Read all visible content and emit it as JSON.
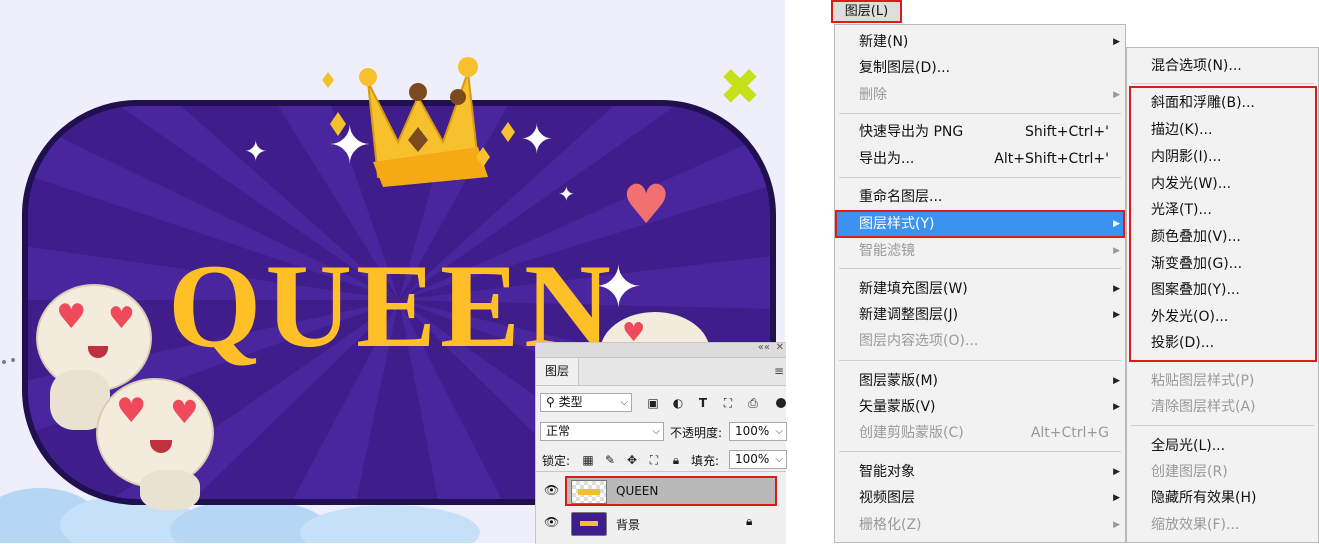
{
  "artwork": {
    "title_text": "QUEEN",
    "colors": {
      "background": "#3f1d8a",
      "border": "#201050",
      "text": "#ffbf26",
      "heart": "#f06070",
      "crown": "#f7c12e"
    }
  },
  "layers_panel": {
    "tab_label": "图层",
    "filter_label": "类型",
    "blend_mode": "正常",
    "opacity_label": "不透明度:",
    "opacity_value": "100%",
    "lock_label": "锁定:",
    "fill_label": "填充:",
    "fill_value": "100%",
    "layers": [
      {
        "name": "QUEEN",
        "selected": true
      },
      {
        "name": "背景",
        "locked": true
      }
    ]
  },
  "menubar": {
    "active_menu": "图层(L)"
  },
  "main_menu": {
    "items": [
      {
        "label": "新建(N)",
        "submenu": true
      },
      {
        "label": "复制图层(D)..."
      },
      {
        "label": "删除",
        "submenu": true,
        "disabled": true
      },
      {
        "label": "快速导出为 PNG",
        "shortcut": "Shift+Ctrl+'"
      },
      {
        "label": "导出为...",
        "shortcut": "Alt+Shift+Ctrl+'"
      },
      {
        "label": "重命名图层..."
      },
      {
        "label": "图层样式(Y)",
        "submenu": true,
        "highlighted": true
      },
      {
        "label": "智能滤镜",
        "submenu": true,
        "disabled": true
      },
      {
        "label": "新建填充图层(W)",
        "submenu": true
      },
      {
        "label": "新建调整图层(J)",
        "submenu": true
      },
      {
        "label": "图层内容选项(O)...",
        "disabled": true
      },
      {
        "label": "图层蒙版(M)",
        "submenu": true
      },
      {
        "label": "矢量蒙版(V)",
        "submenu": true
      },
      {
        "label": "创建剪贴蒙版(C)",
        "shortcut": "Alt+Ctrl+G",
        "disabled": true
      },
      {
        "label": "智能对象",
        "submenu": true
      },
      {
        "label": "视频图层",
        "submenu": true
      },
      {
        "label": "栅格化(Z)",
        "submenu": true,
        "disabled": true
      }
    ]
  },
  "sub_menu": {
    "items": [
      {
        "label": "混合选项(N)..."
      },
      {
        "label": "斜面和浮雕(B)..."
      },
      {
        "label": "描边(K)..."
      },
      {
        "label": "内阴影(I)..."
      },
      {
        "label": "内发光(W)..."
      },
      {
        "label": "光泽(T)..."
      },
      {
        "label": "颜色叠加(V)..."
      },
      {
        "label": "渐变叠加(G)..."
      },
      {
        "label": "图案叠加(Y)..."
      },
      {
        "label": "外发光(O)..."
      },
      {
        "label": "投影(D)..."
      },
      {
        "label": "粘贴图层样式(P)",
        "disabled": true
      },
      {
        "label": "清除图层样式(A)",
        "disabled": true
      },
      {
        "label": "全局光(L)..."
      },
      {
        "label": "创建图层(R)",
        "disabled": true
      },
      {
        "label": "隐藏所有效果(H)"
      },
      {
        "label": "缩放效果(F)...",
        "disabled": true
      }
    ]
  }
}
